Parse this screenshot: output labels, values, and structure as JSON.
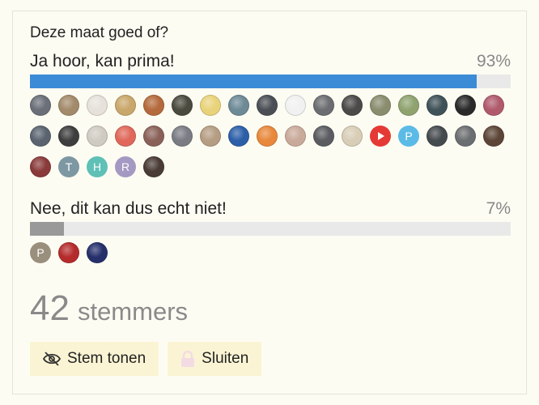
{
  "poll": {
    "question": "Deze maat goed of?",
    "options": [
      {
        "label": "Ja hoor, kan prima!",
        "percent_text": "93%",
        "percent": 93,
        "bar_color": "#3c8bd6",
        "voters": [
          {
            "kind": "photo",
            "color": "#6a6f78"
          },
          {
            "kind": "photo",
            "color": "#a38a6b"
          },
          {
            "kind": "photo",
            "color": "#e6e1da"
          },
          {
            "kind": "photo",
            "color": "#c9a76a"
          },
          {
            "kind": "photo",
            "color": "#b46a3c"
          },
          {
            "kind": "photo",
            "color": "#4a4a3e"
          },
          {
            "kind": "photo",
            "color": "#e9d37a"
          },
          {
            "kind": "photo",
            "color": "#6d8a96"
          },
          {
            "kind": "photo",
            "color": "#4b4f55"
          },
          {
            "kind": "photo",
            "color": "#f1f1f1"
          },
          {
            "kind": "photo",
            "color": "#6b6d70"
          },
          {
            "kind": "photo",
            "color": "#4c4a48"
          },
          {
            "kind": "photo",
            "color": "#8a8d6e"
          },
          {
            "kind": "photo",
            "color": "#8fa36f"
          },
          {
            "kind": "photo",
            "color": "#3f5258"
          },
          {
            "kind": "photo",
            "color": "#2a2a2a"
          },
          {
            "kind": "photo",
            "color": "#b05a6c"
          },
          {
            "kind": "photo",
            "color": "#5a6470"
          },
          {
            "kind": "photo",
            "color": "#3e3e3e"
          },
          {
            "kind": "photo",
            "color": "#d0cbc2"
          },
          {
            "kind": "photo",
            "color": "#e0675a"
          },
          {
            "kind": "photo",
            "color": "#8a6158"
          },
          {
            "kind": "photo",
            "color": "#7a7c84"
          },
          {
            "kind": "photo",
            "color": "#b59d83"
          },
          {
            "kind": "photo",
            "color": "#2c5fa8"
          },
          {
            "kind": "photo",
            "color": "#e8883c"
          },
          {
            "kind": "photo",
            "color": "#c9aa9a"
          },
          {
            "kind": "photo",
            "color": "#5a5c60"
          },
          {
            "kind": "photo",
            "color": "#d8cdb6"
          },
          {
            "kind": "play",
            "color": "#e53935"
          },
          {
            "kind": "letter",
            "letter": "P",
            "color": "#5bbbe6"
          },
          {
            "kind": "photo",
            "color": "#454a4e"
          },
          {
            "kind": "photo",
            "color": "#6b6e70"
          },
          {
            "kind": "photo",
            "color": "#5c4537"
          },
          {
            "kind": "photo",
            "color": "#8a3a3a"
          },
          {
            "kind": "letter",
            "letter": "T",
            "color": "#7e98a3"
          },
          {
            "kind": "letter",
            "letter": "H",
            "color": "#5fc0b6"
          },
          {
            "kind": "letter",
            "letter": "R",
            "color": "#a399c2"
          },
          {
            "kind": "photo",
            "color": "#4a3b36"
          }
        ]
      },
      {
        "label": "Nee, dit kan dus echt niet!",
        "percent_text": "7%",
        "percent": 7,
        "bar_color": "#999999",
        "voters": [
          {
            "kind": "letter",
            "letter": "P",
            "color": "#9a8f7c"
          },
          {
            "kind": "photo",
            "color": "#b52b2b"
          },
          {
            "kind": "photo",
            "color": "#25306b"
          }
        ]
      }
    ],
    "total_count": "42",
    "total_label": "stemmers",
    "buttons": {
      "show_votes": "Stem tonen",
      "close": "Sluiten"
    }
  }
}
